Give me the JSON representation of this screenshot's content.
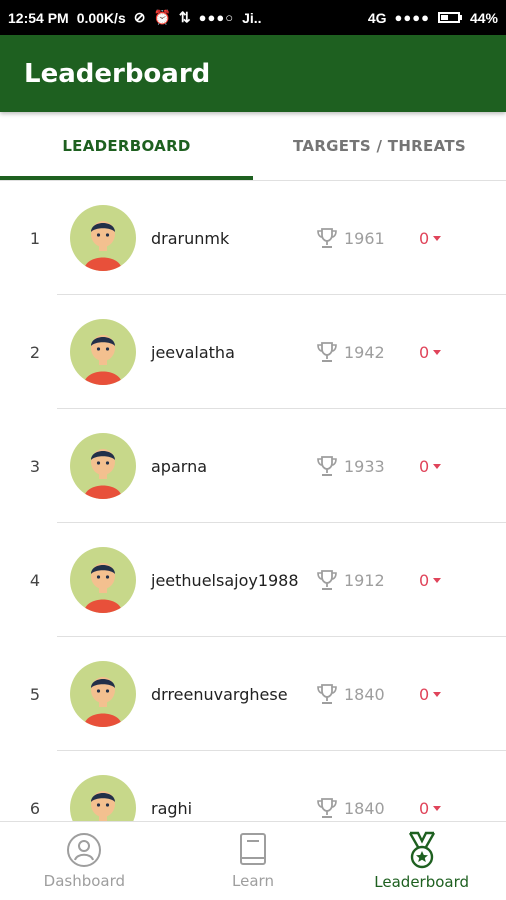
{
  "status": {
    "time": "12:54 PM",
    "speed": "0.00K/s",
    "carrier": "Ji..",
    "network": "4G",
    "battery": "44%"
  },
  "appbar": {
    "title": "Leaderboard"
  },
  "tabs": [
    {
      "label": "LEADERBOARD",
      "active": true
    },
    {
      "label": "TARGETS / THREATS",
      "active": false
    }
  ],
  "rows": [
    {
      "rank": "1",
      "name": "drarunmk",
      "score": "1961",
      "delta": "0"
    },
    {
      "rank": "2",
      "name": "jeevalatha",
      "score": "1942",
      "delta": "0"
    },
    {
      "rank": "3",
      "name": "aparna",
      "score": "1933",
      "delta": "0"
    },
    {
      "rank": "4",
      "name": "jeethuelsajoy1988",
      "score": "1912",
      "delta": "0"
    },
    {
      "rank": "5",
      "name": "drreenuvarghese",
      "score": "1840",
      "delta": "0"
    },
    {
      "rank": "6",
      "name": "raghi",
      "score": "1840",
      "delta": "0"
    }
  ],
  "bottomnav": [
    {
      "label": "Dashboard",
      "icon": "dashboard-user-icon"
    },
    {
      "label": "Learn",
      "icon": "book-icon"
    },
    {
      "label": "Leaderboard",
      "icon": "medal-icon"
    }
  ],
  "colors": {
    "primary": "#1e6020",
    "negative": "#e0445a",
    "avatar_bg": "#c7d88a"
  }
}
